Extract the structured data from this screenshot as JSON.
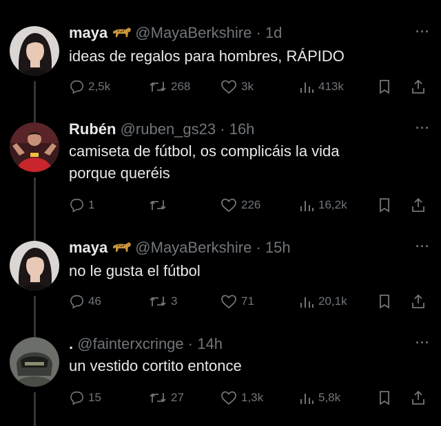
{
  "tweets": [
    {
      "display_name": "maya",
      "badge_icon": "leopard-icon",
      "handle": "@MayaBerkshire",
      "time": "1d",
      "text_lines": [
        "ideas de regalos para hombres, RÁPIDO"
      ],
      "stats": {
        "replies": "2,5k",
        "retweets": "268",
        "likes": "3k",
        "views": "413k"
      }
    },
    {
      "display_name": "Rubén",
      "handle": "@ruben_gs23",
      "time": "16h",
      "text_lines": [
        "camiseta de fútbol, os complicáis la vida",
        "porque queréis"
      ],
      "stats": {
        "replies": "1",
        "retweets": "",
        "likes": "226",
        "views": "16,2k"
      }
    },
    {
      "display_name": "maya",
      "badge_icon": "leopard-icon",
      "handle": "@MayaBerkshire",
      "time": "15h",
      "text_lines": [
        "no le gusta el fútbol"
      ],
      "stats": {
        "replies": "46",
        "retweets": "3",
        "likes": "71",
        "views": "20,1k"
      }
    },
    {
      "display_name": ".",
      "handle": "@fainterxcringe",
      "time": "14h",
      "text_lines": [
        "un vestido cortito entonce"
      ],
      "stats": {
        "replies": "15",
        "retweets": "27",
        "likes": "1,3k",
        "views": "5,8k"
      }
    }
  ],
  "separator": "·",
  "more_label": "···",
  "colors": {
    "background": "#000000",
    "primary_text": "#e7e9ea",
    "secondary_text": "#71767b",
    "thread_line": "#333639",
    "badge": "#c8943c"
  },
  "icons": [
    "reply-icon",
    "retweet-icon",
    "like-icon",
    "views-icon",
    "bookmark-icon",
    "share-icon",
    "more-icon"
  ]
}
